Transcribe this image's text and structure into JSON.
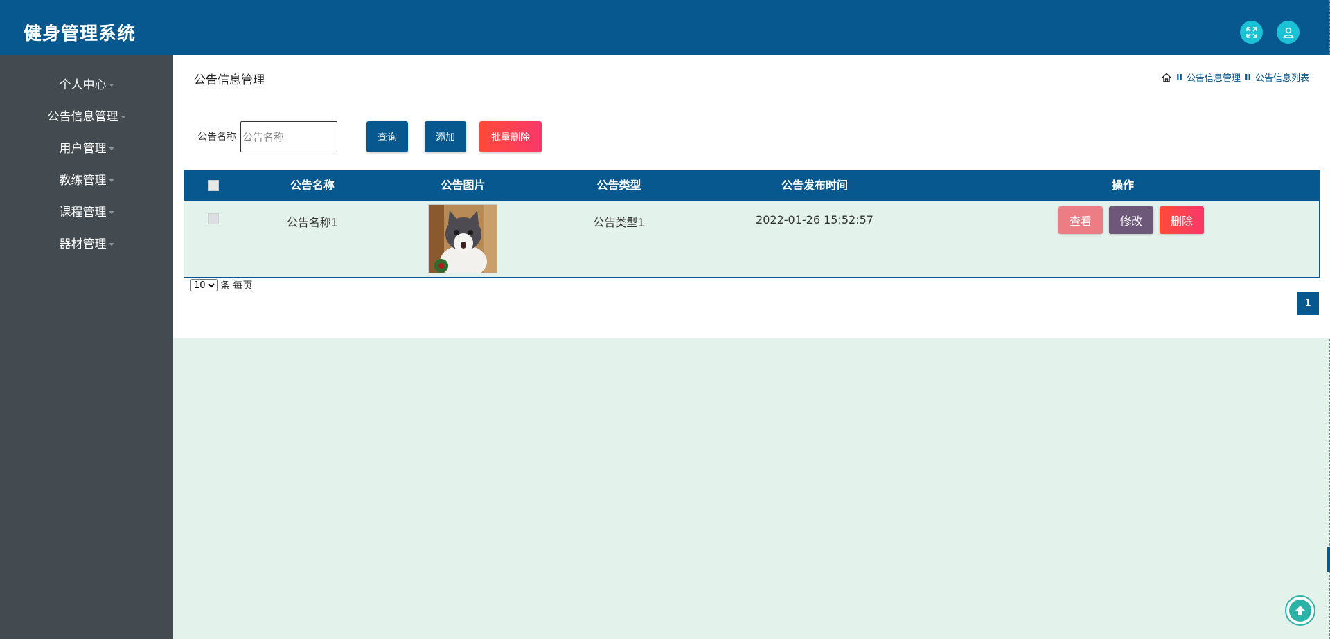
{
  "header": {
    "app_title": "健身管理系统",
    "icons": [
      "fullscreen-icon",
      "user-icon"
    ]
  },
  "sidebar": {
    "items": [
      {
        "label": "个人中心"
      },
      {
        "label": "公告信息管理"
      },
      {
        "label": "用户管理"
      },
      {
        "label": "教练管理"
      },
      {
        "label": "课程管理"
      },
      {
        "label": "器材管理"
      }
    ]
  },
  "page": {
    "heading": "公告信息管理",
    "breadcrumb": {
      "sep": "II",
      "items": [
        "公告信息管理",
        "公告信息列表"
      ]
    }
  },
  "search": {
    "label": "公告名称",
    "placeholder": "公告名称",
    "value": "",
    "query_label": "查询",
    "add_label": "添加",
    "bulk_delete_label": "批量删除"
  },
  "table": {
    "columns": [
      "公告名称",
      "公告图片",
      "公告类型",
      "公告发布时间",
      "操作"
    ],
    "rows": [
      {
        "name": "公告名称1",
        "image": "cat-photo",
        "type": "公告类型1",
        "publish_time": "2022-01-26 15:52:57",
        "actions": {
          "view": "查看",
          "edit": "修改",
          "delete": "删除"
        }
      }
    ]
  },
  "pagination": {
    "page_size": "10",
    "page_size_options": [
      "10"
    ],
    "page_size_suffix": "条 每页",
    "current_page": "1"
  },
  "colors": {
    "primary": "#06588e",
    "sidebar": "#434b50",
    "background": "#e4f2ec",
    "accent_cyan": "#1ac2d6",
    "danger": "#ff4a3a",
    "view_pink": "#ec7d85",
    "edit_purple": "#6d587a"
  }
}
